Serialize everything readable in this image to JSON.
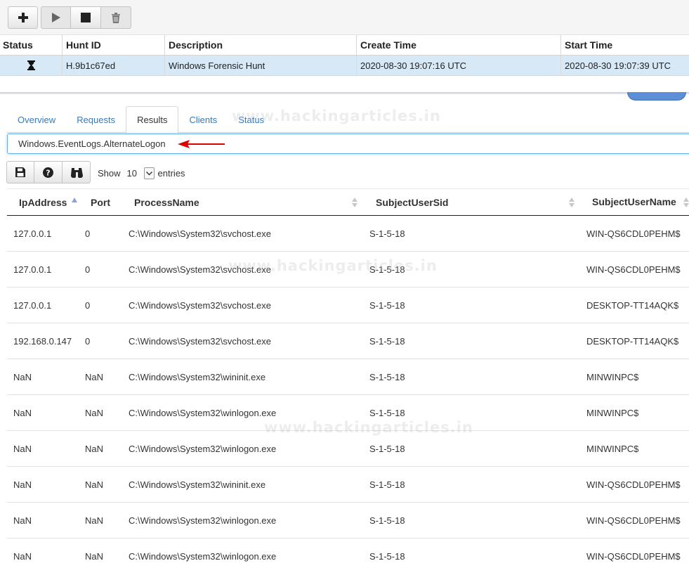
{
  "toolbar": {
    "buttons": [
      {
        "icon": "plus-icon"
      },
      {
        "icon": "play-icon"
      },
      {
        "icon": "stop-icon"
      },
      {
        "icon": "trash-icon"
      }
    ]
  },
  "hunts": {
    "columns": [
      "Status",
      "Hunt ID",
      "Description",
      "Create Time",
      "Start Time"
    ],
    "rows": [
      {
        "status_icon": "hourglass-icon",
        "hunt_id": "H.9b1c67ed",
        "description": "Windows Forensic Hunt",
        "create_time": "2020-08-30 19:07:16 UTC",
        "start_time": "2020-08-30 19:07:39 UTC"
      }
    ]
  },
  "tabs": [
    "Overview",
    "Requests",
    "Results",
    "Clients",
    "Status"
  ],
  "active_tab": "Results",
  "artifact": {
    "value": "Windows.EventLogs.AlternateLogon"
  },
  "results_toolbar": {
    "buttons": [
      {
        "icon": "save-icon"
      },
      {
        "icon": "help-icon"
      },
      {
        "icon": "binoculars-icon"
      }
    ],
    "show_label": "Show",
    "page_size": "10",
    "entries_label": "entries"
  },
  "results": {
    "columns": [
      "IpAddress",
      "Port",
      "ProcessName",
      "SubjectUserSid",
      "SubjectUserName"
    ],
    "rows": [
      {
        "ip": "127.0.0.1",
        "port": "0",
        "process": "C:\\Windows\\System32\\svchost.exe",
        "sid": "S-1-5-18",
        "user": "WIN-QS6CDL0PEHM$"
      },
      {
        "ip": "127.0.0.1",
        "port": "0",
        "process": "C:\\Windows\\System32\\svchost.exe",
        "sid": "S-1-5-18",
        "user": "WIN-QS6CDL0PEHM$"
      },
      {
        "ip": "127.0.0.1",
        "port": "0",
        "process": "C:\\Windows\\System32\\svchost.exe",
        "sid": "S-1-5-18",
        "user": "DESKTOP-TT14AQK$"
      },
      {
        "ip": "192.168.0.147",
        "port": "0",
        "process": "C:\\Windows\\System32\\svchost.exe",
        "sid": "S-1-5-18",
        "user": "DESKTOP-TT14AQK$"
      },
      {
        "ip": "NaN",
        "port": "NaN",
        "process": "C:\\Windows\\System32\\wininit.exe",
        "sid": "S-1-5-18",
        "user": "MINWINPC$"
      },
      {
        "ip": "NaN",
        "port": "NaN",
        "process": "C:\\Windows\\System32\\winlogon.exe",
        "sid": "S-1-5-18",
        "user": "MINWINPC$"
      },
      {
        "ip": "NaN",
        "port": "NaN",
        "process": "C:\\Windows\\System32\\winlogon.exe",
        "sid": "S-1-5-18",
        "user": "MINWINPC$"
      },
      {
        "ip": "NaN",
        "port": "NaN",
        "process": "C:\\Windows\\System32\\wininit.exe",
        "sid": "S-1-5-18",
        "user": "WIN-QS6CDL0PEHM$"
      },
      {
        "ip": "NaN",
        "port": "NaN",
        "process": "C:\\Windows\\System32\\winlogon.exe",
        "sid": "S-1-5-18",
        "user": "WIN-QS6CDL0PEHM$"
      },
      {
        "ip": "NaN",
        "port": "NaN",
        "process": "C:\\Windows\\System32\\winlogon.exe",
        "sid": "S-1-5-18",
        "user": "WIN-QS6CDL0PEHM$"
      }
    ]
  },
  "watermark": "www.hackingarticles.in",
  "colors": {
    "accent": "#3a7ab7",
    "selected_row": "#d7e9f6",
    "annotation_arrow": "#e00000",
    "sort_active": "#8ea0dc"
  }
}
